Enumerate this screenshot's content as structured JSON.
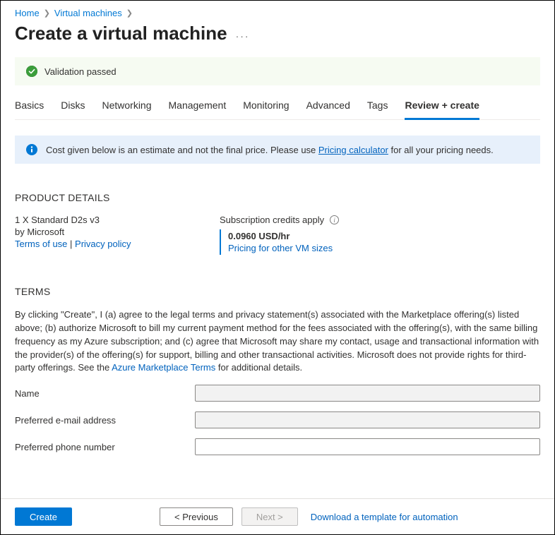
{
  "breadcrumb": {
    "home": "Home",
    "vms": "Virtual machines"
  },
  "page_title": "Create a virtual machine",
  "validation": {
    "message": "Validation passed"
  },
  "tabs": {
    "basics": "Basics",
    "disks": "Disks",
    "networking": "Networking",
    "management": "Management",
    "monitoring": "Monitoring",
    "advanced": "Advanced",
    "tags": "Tags",
    "review": "Review + create"
  },
  "info_banner": {
    "prefix": "Cost given below is an estimate and not the final price. Please use ",
    "link": "Pricing calculator",
    "suffix": " for all your pricing needs."
  },
  "sections": {
    "product_details": "PRODUCT DETAILS",
    "terms": "TERMS"
  },
  "product": {
    "name": "1 X Standard D2s v3",
    "vendor": "by Microsoft",
    "terms_link": "Terms of use",
    "sep": " | ",
    "privacy_link": "Privacy policy",
    "credits_label": "Subscription credits apply",
    "price": "0.0960 USD/hr",
    "other_sizes_link": "Pricing for other VM sizes"
  },
  "terms_text": {
    "body": "By clicking \"Create\", I (a) agree to the legal terms and privacy statement(s) associated with the Marketplace offering(s) listed above; (b) authorize Microsoft to bill my current payment method for the fees associated with the offering(s), with the same billing frequency as my Azure subscription; and (c) agree that Microsoft may share my contact, usage and transactional information with the provider(s) of the offering(s) for support, billing and other transactional activities. Microsoft does not provide rights for third-party offerings. See the ",
    "link": "Azure Marketplace Terms",
    "suffix": " for additional details."
  },
  "form": {
    "name_label": "Name",
    "email_label": "Preferred e-mail address",
    "phone_label": "Preferred phone number"
  },
  "footer": {
    "create": "Create",
    "previous": "< Previous",
    "next": "Next >",
    "download_link": "Download a template for automation"
  }
}
